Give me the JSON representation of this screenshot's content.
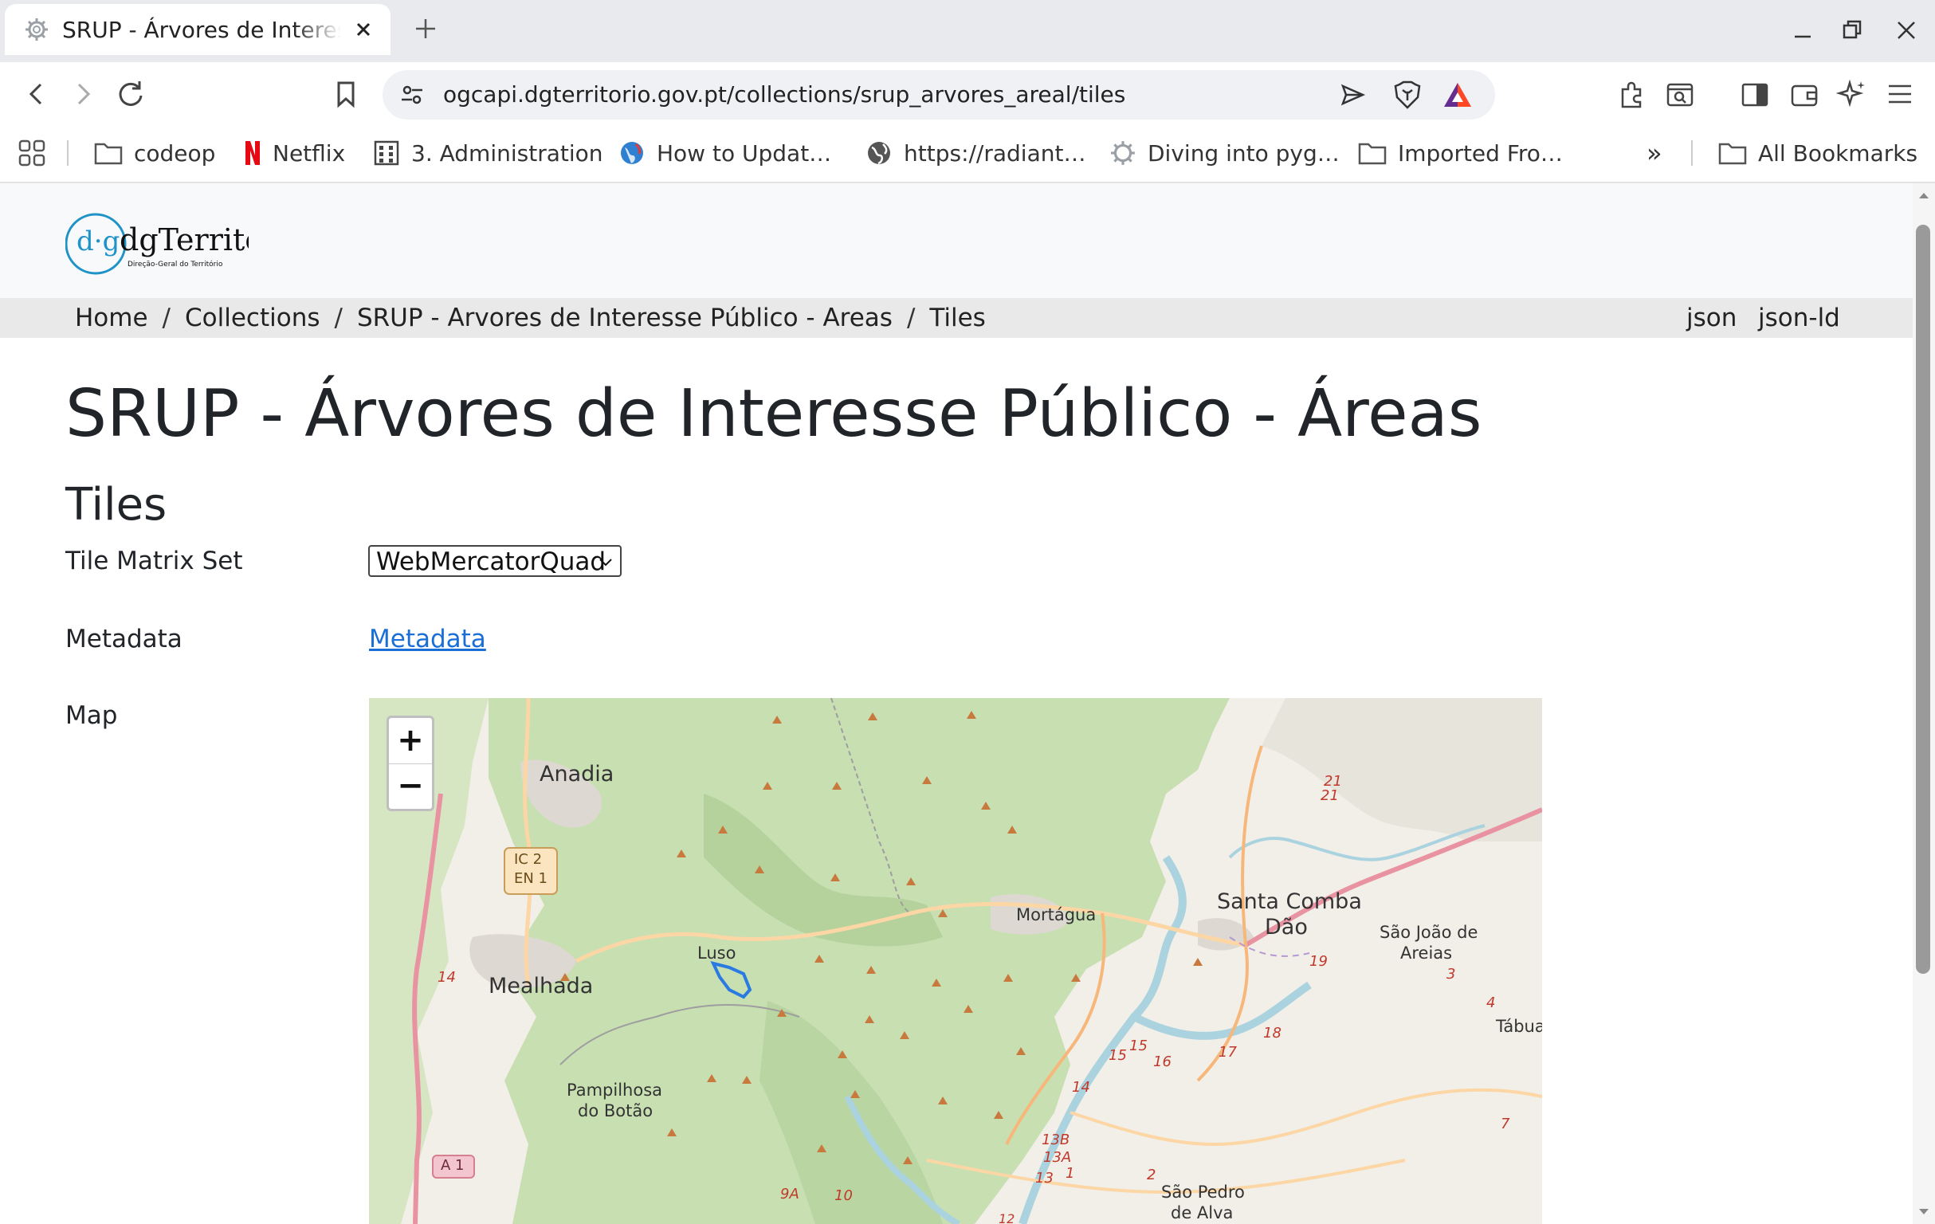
{
  "browser": {
    "tab_title": "SRUP - Árvores de Interesse Público - Áreas",
    "url": "ogcapi.dgterritorio.gov.pt/collections/srup_arvores_areal/tiles",
    "bookmarks": [
      "codeop",
      "Netflix",
      "3. Administration",
      "How to Updat…",
      "https://radiant…",
      "Diving into pyg…",
      "Imported Fro…"
    ],
    "all_bookmarks": "All Bookmarks",
    "more_bookmarks": "»"
  },
  "site": {
    "logo_text": "dgTerritório",
    "logo_subtext": "Direção-Geral do Território"
  },
  "breadcrumb": {
    "items": [
      "Home",
      "Collections",
      "SRUP - Arvores de Interesse Público - Areas",
      "Tiles"
    ],
    "formats": [
      "json",
      "json-ld"
    ]
  },
  "main": {
    "title": "SRUP - Árvores de Interesse Público - Áreas",
    "subtitle": "Tiles",
    "tile_matrix_label": "Tile Matrix Set",
    "tile_matrix_value": "WebMercatorQuad",
    "metadata_label": "Metadata",
    "metadata_link": "Metadata",
    "map_label": "Map"
  },
  "map": {
    "zoom_in": "+",
    "zoom_out": "−",
    "places": [
      "Anadia",
      "Mealhada",
      "Luso",
      "Mortágua",
      "Santa Comba",
      "Dão",
      "São João de",
      "Areias",
      "Pampilhosa",
      "do Botão",
      "São Pedro",
      "de Alva",
      "Tábua"
    ],
    "road_shields": [
      "IC 2",
      "EN 1",
      "A 1"
    ],
    "road_numbers": [
      "14",
      "21",
      "21",
      "19",
      "3",
      "4",
      "18",
      "17",
      "15",
      "15",
      "16",
      "14",
      "13B",
      "13A",
      "13",
      "1",
      "2",
      "7",
      "9A",
      "10",
      "12"
    ]
  }
}
